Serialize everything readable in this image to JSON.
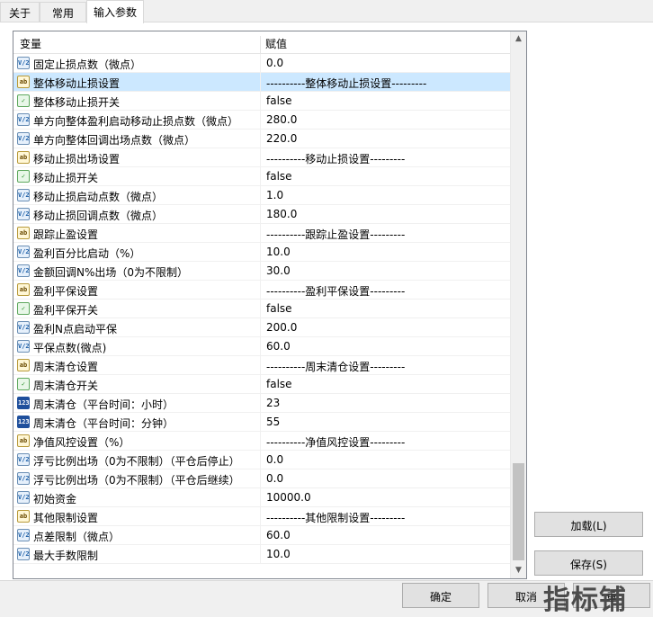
{
  "tabs": [
    "关于",
    "常用",
    "输入参数"
  ],
  "grid": {
    "col_variable": "变量",
    "col_value": "赋值",
    "rows": [
      {
        "type": "double",
        "name": "固定止损点数（微点）",
        "value": "0.0"
      },
      {
        "type": "string",
        "name": "整体移动止损设置",
        "value": "----------整体移动止损设置---------",
        "selected": true
      },
      {
        "type": "bool",
        "name": "整体移动止损开关",
        "value": "false"
      },
      {
        "type": "double",
        "name": "单方向整体盈利启动移动止损点数（微点）",
        "value": "280.0"
      },
      {
        "type": "double",
        "name": "单方向整体回调出场点数（微点）",
        "value": "220.0"
      },
      {
        "type": "string",
        "name": "移动止损出场设置",
        "value": "----------移动止损设置---------"
      },
      {
        "type": "bool",
        "name": "移动止损开关",
        "value": "false"
      },
      {
        "type": "double",
        "name": "移动止损启动点数（微点）",
        "value": "1.0"
      },
      {
        "type": "double",
        "name": "移动止损回调点数（微点）",
        "value": "180.0"
      },
      {
        "type": "string",
        "name": "跟踪止盈设置",
        "value": "----------跟踪止盈设置---------"
      },
      {
        "type": "double",
        "name": "盈利百分比启动（%）",
        "value": "10.0"
      },
      {
        "type": "double",
        "name": "金额回调N%出场（0为不限制）",
        "value": "30.0"
      },
      {
        "type": "string",
        "name": "盈利平保设置",
        "value": "----------盈利平保设置---------"
      },
      {
        "type": "bool",
        "name": "盈利平保开关",
        "value": "false"
      },
      {
        "type": "double",
        "name": "盈利N点启动平保",
        "value": "200.0"
      },
      {
        "type": "double",
        "name": "平保点数(微点)",
        "value": "60.0"
      },
      {
        "type": "string",
        "name": "周末清仓设置",
        "value": "----------周末清仓设置---------"
      },
      {
        "type": "bool",
        "name": "周末清仓开关",
        "value": "false"
      },
      {
        "type": "int",
        "name": "周末清仓（平台时间：小时）",
        "value": "23"
      },
      {
        "type": "int",
        "name": "周末清仓（平台时间：分钟）",
        "value": "55"
      },
      {
        "type": "string",
        "name": "净值风控设置（%）",
        "value": "----------净值风控设置---------"
      },
      {
        "type": "double",
        "name": "浮亏比例出场（0为不限制）（平仓后停止）",
        "value": "0.0"
      },
      {
        "type": "double",
        "name": "浮亏比例出场（0为不限制）（平仓后继续）",
        "value": "0.0"
      },
      {
        "type": "double",
        "name": "初始资金",
        "value": "10000.0"
      },
      {
        "type": "string",
        "name": "其他限制设置",
        "value": "----------其他限制设置---------"
      },
      {
        "type": "double",
        "name": "点差限制（微点）",
        "value": "60.0"
      },
      {
        "type": "double",
        "name": "最大手数限制",
        "value": "10.0"
      }
    ]
  },
  "icons": {
    "double": "V/2",
    "string": "ab",
    "bool": "✓",
    "int": "123"
  },
  "buttons": {
    "load": "加载(L)",
    "save": "保存(S)",
    "ok": "确定",
    "cancel": "取消",
    "reset": "重"
  },
  "watermark": "指标铺"
}
